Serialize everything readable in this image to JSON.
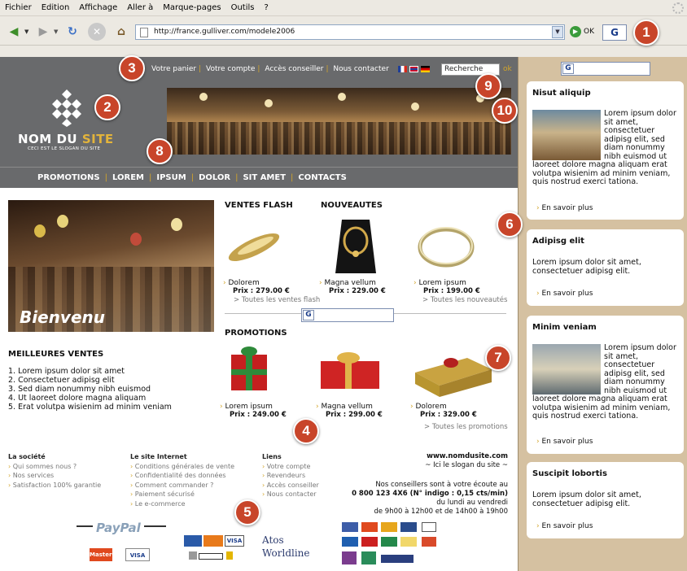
{
  "browser": {
    "menu": [
      "Fichier",
      "Edition",
      "Affichage",
      "Aller à",
      "Marque-pages",
      "Outils",
      "?"
    ],
    "url": "http://france.gulliver.com/modele2006",
    "go_label": "OK",
    "google_glyph": "G"
  },
  "header": {
    "top_links": [
      "Votre panier",
      "Votre compte",
      "Accès conseiller",
      "Nous contacter"
    ],
    "search_value": "Recherche",
    "search_ok": "ok",
    "logo_name_a": "NOM DU ",
    "logo_name_b": "SITE",
    "slogan": "CECI EST LE SLOGAN DU SITE"
  },
  "nav": [
    "PROMOTIONS",
    "LOREM",
    "IPSUM",
    "DOLOR",
    "SIT AMET",
    "CONTACTS"
  ],
  "hero_title": "Bienvenu",
  "best_sellers": {
    "title": "MEILLEURES VENTES",
    "items": [
      "1. Lorem ipsum dolor sit amet",
      "2. Consectetuer adipisg elit",
      "3. Sed diam nonummy nibh euismod",
      "4. Ut laoreet dolore magna aliquam",
      "5. Erat volutpa wisienim ad minim veniam"
    ]
  },
  "sections": {
    "flash_title": "VENTES FLASH",
    "new_title": "NOUVEAUTES",
    "promo_title": "PROMOTIONS",
    "all_flash": "Toutes les ventes flash",
    "all_new": "Toutes les nouveautés",
    "all_promo": "Toutes les promotions"
  },
  "products_top": [
    {
      "name": "Dolorem",
      "price": "Prix : 279.00 €"
    },
    {
      "name": "Magna vellum",
      "price": "Prix : 229.00 €"
    },
    {
      "name": "Lorem ipsum",
      "price": "Prix : 199.00 €"
    }
  ],
  "products_promo": [
    {
      "name": "Lorem ipsum",
      "price": "Prix : 249.00 €"
    },
    {
      "name": "Magna vellum",
      "price": "Prix : 299.00 €"
    },
    {
      "name": "Dolorem",
      "price": "Prix : 329.00 €"
    }
  ],
  "footer": {
    "col1": {
      "head": "La société",
      "links": [
        "Qui sommes nous ?",
        "Nos services",
        "Satisfaction 100% garantie"
      ]
    },
    "col2": {
      "head": "Le site Internet",
      "links": [
        "Conditions générales de vente",
        "Confidentialité des données",
        "Comment commander ?",
        "Paiement sécurisé",
        "Le e-commerce"
      ]
    },
    "col3": {
      "head": "Liens",
      "links": [
        "Votre compte",
        "Revendeurs",
        "Accès conseiller",
        "Nous contacter"
      ]
    },
    "contact": {
      "domain": "www.nomdusite.com",
      "slogan": "~ Ici le slogan du site ~",
      "line1": "Nos conseillers sont à votre écoute au",
      "line2": "0 800 123 4X6 (N° indigo : 0,15 cts/min)",
      "line3": "du lundi au vendredi",
      "line4": "de 9h00 à 12h00 et de 14h00 à 19h00"
    },
    "paypal": "PayPal",
    "cards": [
      "MasterCard",
      "VISA"
    ],
    "atos_a": "Atos",
    "atos_b": "Worldline"
  },
  "sidebar": [
    {
      "title": "Nisut aliquip",
      "body": "Lorem ipsum dolor sit amet, consectetuer adipisg elit, sed diam nonummy nibh euismod ut laoreet dolore magna aliquam erat volutpa wisienim ad minim veniam, quis nostrud exerci tationa.",
      "link": "En savoir plus"
    },
    {
      "title": "Adipisg elit",
      "body": "Lorem ipsum dolor sit amet, consectetuer adipisg elit.",
      "link": "En savoir plus"
    },
    {
      "title": "Minim veniam",
      "body": "Lorem ipsum dolor sit amet, consectetuer adipisg elit, sed diam nonummy nibh euismod ut laoreet dolore magna aliquam erat volutpa wisienim ad minim veniam, quis nostrud exerci tationa.",
      "link": "En savoir plus"
    },
    {
      "title": "Suscipit lobortis",
      "body": "Lorem ipsum dolor sit amet, consectetuer adipisg elit.",
      "link": "En savoir plus"
    }
  ],
  "callouts": [
    "1",
    "2",
    "3",
    "4",
    "5",
    "6",
    "7",
    "8",
    "9",
    "10"
  ],
  "colors": {
    "header_gray": "#696a6c",
    "accent_gold": "#d3a52a",
    "sidebar_tan": "#d5c1a1",
    "callout_red": "#c8452a"
  }
}
